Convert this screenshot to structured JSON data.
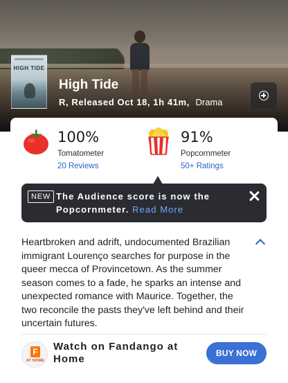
{
  "movie": {
    "title": "High Tide",
    "poster_title": "HIGH TIDE",
    "rating": "R, Released Oct 18, 1h 41m,",
    "genre": "Drama"
  },
  "scores": {
    "tomatometer": {
      "value": "100%",
      "label": "Tomatometer",
      "link": "20 Reviews",
      "icon": "tomato-icon",
      "color": "#e8312a"
    },
    "popcornmeter": {
      "value": "91%",
      "label": "Popcornmeter",
      "link": "50+ Ratings",
      "icon": "popcorn-icon",
      "color": "#e8312a"
    }
  },
  "notice": {
    "badge": "NEW",
    "message": "The Audience score is now the Popcornmeter.",
    "read_more": "Read More"
  },
  "synopsis": "Heartbroken and adrift, undocumented Brazilian immigrant Lourenço searches for purpose in the queer mecca of Provincetown. As the summer season comes to a fade, he sparks an intense and unexpected romance with Maurice. Together, the two reconcile the pasts they've left behind and their uncertain futures.",
  "watch": {
    "text": "Watch on Fandango at Home",
    "button": "BUY NOW",
    "logo_letter": "F",
    "logo_caption": "AT HOME"
  },
  "colors": {
    "accent": "#3b70d4",
    "link": "#2a62c9",
    "notice_bg": "#2a2c32",
    "fandango": "#ff7300"
  }
}
